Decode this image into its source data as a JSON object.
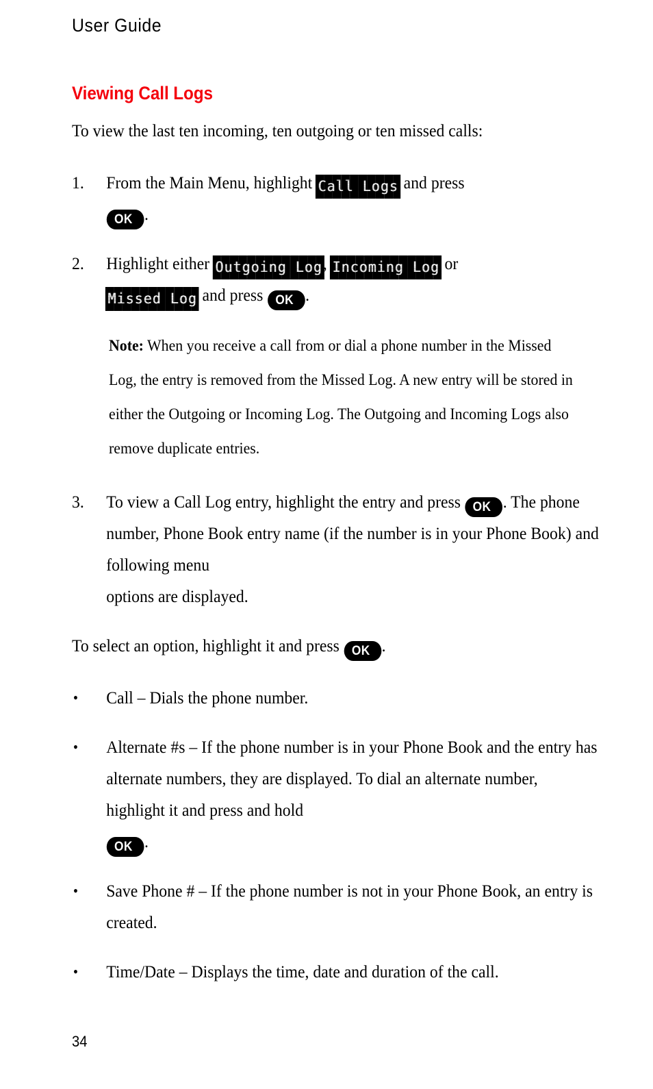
{
  "page": {
    "running_head": "User Guide",
    "folio": "34",
    "heading_color": "#f4000c"
  },
  "section": {
    "heading": "Viewing Call Logs",
    "intro": "To view the last ten incoming, ten outgoing or ten missed calls:"
  },
  "steps": [
    {
      "marker": "1.",
      "text_before": "From the Main Menu, highlight",
      "lcd": "Call Logs",
      "text_middle": "and press",
      "key": "OK",
      "text_after": "."
    },
    {
      "marker": "2.",
      "text_before": "Highlight either",
      "lcd_1": "Outgoing Log",
      "separator_1": ",",
      "lcd_2": "Incoming Log",
      "text_middle": "or",
      "lcd_3": "Missed Log",
      "text_after": "and press",
      "key": "OK",
      "text_end": "."
    },
    {
      "marker": "3.",
      "text_before": "To view a Call Log entry, highlight the entry and press",
      "key": "OK",
      "text_after": ". The phone number, Phone Book entry name (if the number is in your Phone Book) and following menu",
      "text_lastline": "options are displayed."
    }
  ],
  "note": {
    "label": "Note:",
    "text": "When you receive a call from or dial a phone number in the Missed Log, the entry is removed from the Missed Log. A new entry will be stored in either the Outgoing or Incoming Log. The Outgoing and Incoming Logs also remove duplicate entries."
  },
  "select_instruction": {
    "text_before": "To select an option, highlight it and press",
    "key": "OK",
    "text_after": "."
  },
  "options": [
    {
      "marker": "•",
      "text": "Call – Dials the phone number."
    },
    {
      "marker": "•",
      "text_before": "Alternate #s – If the phone number is in your Phone Book and the entry has alternate numbers, they are displayed. To dial an alternate number, highlight it and press and hold",
      "key": "OK",
      "text_after": "."
    },
    {
      "marker": "•",
      "text": "Save Phone # – If the phone number is not in your Phone Book, an entry is created."
    },
    {
      "marker": "•",
      "text": "Time/Date – Displays the time, date and duration of the call."
    }
  ]
}
